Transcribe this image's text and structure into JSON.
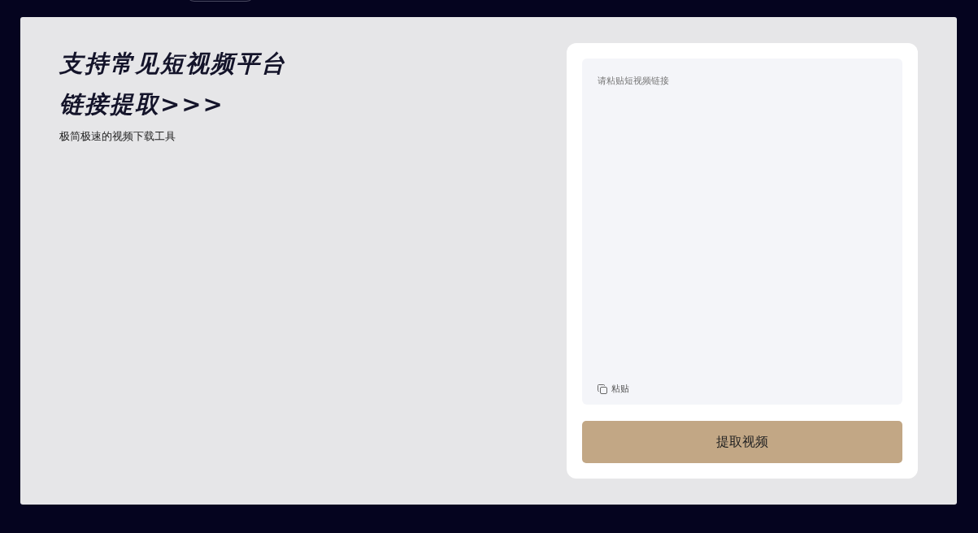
{
  "hero": {
    "title_lines": [
      "支持常见短视频平台",
      "链接提取>>>"
    ],
    "subtitle": "极简极速的视频下载工具"
  },
  "form": {
    "link_field": {
      "placeholder": "请粘贴短视频链接"
    },
    "paste_button": "粘贴",
    "submit_button": "提取视频"
  }
}
